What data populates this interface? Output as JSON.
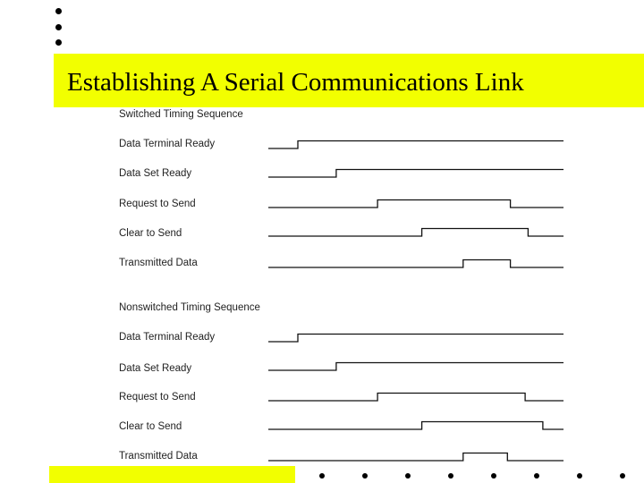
{
  "slide": {
    "title": "Establishing A Serial Communications Link",
    "accent_color": "#f2ff00",
    "top_bullets": 3,
    "bottom_bullets": 8
  },
  "diagram": {
    "sections": [
      {
        "title": "Switched Timing Sequence",
        "signals": [
          {
            "label": "Data Terminal Ready",
            "rise": 0.1,
            "fall": null
          },
          {
            "label": "Data Set Ready",
            "rise": 0.23,
            "fall": null
          },
          {
            "label": "Request to Send",
            "rise": 0.37,
            "fall": 0.82
          },
          {
            "label": "Clear to Send",
            "rise": 0.52,
            "fall": 0.88
          },
          {
            "label": "Transmitted Data",
            "rise": 0.66,
            "fall": 0.82
          }
        ]
      },
      {
        "title": "Nonswitched Timing Sequence",
        "signals": [
          {
            "label": "Data Terminal Ready",
            "rise": 0.1,
            "fall": null
          },
          {
            "label": "Data Set Ready",
            "rise": 0.23,
            "fall": null
          },
          {
            "label": "Request to Send",
            "rise": 0.37,
            "fall": 0.87
          },
          {
            "label": "Clear to Send",
            "rise": 0.52,
            "fall": 0.93
          },
          {
            "label": "Transmitted Data",
            "rise": 0.66,
            "fall": 0.81
          }
        ]
      }
    ]
  }
}
